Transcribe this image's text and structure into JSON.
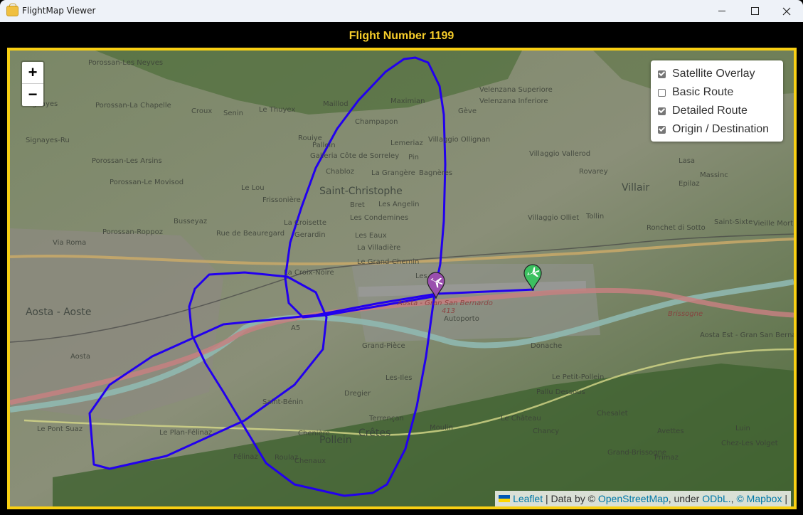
{
  "window": {
    "title": "FlightMap Viewer",
    "minimize_label": "Minimize",
    "maximize_label": "Maximize",
    "close_label": "Close"
  },
  "header": {
    "flight_title": "Flight Number 1199",
    "title_color": "#f5cc2a",
    "frame_color": "#f9d013"
  },
  "map": {
    "zoom_in_label": "+",
    "zoom_out_label": "−",
    "route_color": "#2200ee",
    "origin_marker": {
      "color": "#3cc060",
      "icon": "airplane-icon",
      "role": "origin"
    },
    "destination_marker": {
      "color": "#9a4fae",
      "icon": "airplane-icon",
      "role": "destination"
    },
    "places": [
      {
        "name": "Porossan-Les Neyves"
      },
      {
        "name": "Signayes"
      },
      {
        "name": "Porossan-La Chapelle"
      },
      {
        "name": "Croux"
      },
      {
        "name": "Senin"
      },
      {
        "name": "Le Thuyex"
      },
      {
        "name": "Signayes-Ru"
      },
      {
        "name": "Porossan-Les Arsins"
      },
      {
        "name": "Porossan-Le Movisod"
      },
      {
        "name": "Le Lou"
      },
      {
        "name": "Frissonière"
      },
      {
        "name": "Busseyaz"
      },
      {
        "name": "Porossan-Roppoz"
      },
      {
        "name": "Via Roma"
      },
      {
        "name": "Rue de Beauregard"
      },
      {
        "name": "Aosta - Aoste"
      },
      {
        "name": "Aosta"
      },
      {
        "name": "Maillod"
      },
      {
        "name": "Maximian"
      },
      {
        "name": "Champapon"
      },
      {
        "name": "Gève"
      },
      {
        "name": "Rouiye"
      },
      {
        "name": "Pallein"
      },
      {
        "name": "Galleria Côte de Sorreley"
      },
      {
        "name": "Lemeriaz"
      },
      {
        "name": "Pin"
      },
      {
        "name": "Villaggio Ollignan"
      },
      {
        "name": "Chabloz"
      },
      {
        "name": "La Grangère"
      },
      {
        "name": "Bagnères"
      },
      {
        "name": "Saint-Christophe"
      },
      {
        "name": "Bret"
      },
      {
        "name": "Les Angelin"
      },
      {
        "name": "Les Condemines"
      },
      {
        "name": "La Croisette"
      },
      {
        "name": "Gerardin"
      },
      {
        "name": "Les Eaux"
      },
      {
        "name": "La Villadière"
      },
      {
        "name": "Le Grand-Chemin"
      },
      {
        "name": "La Croix-Noire"
      },
      {
        "name": "Les..."
      },
      {
        "name": "Velenzana Superiore"
      },
      {
        "name": "Velenzana Inferiore"
      },
      {
        "name": "Villaggio Vallerod"
      },
      {
        "name": "Rovarey"
      },
      {
        "name": "Villair"
      },
      {
        "name": "Tollin"
      },
      {
        "name": "Villaggio Olliet"
      },
      {
        "name": "Massinc"
      },
      {
        "name": "Lasa"
      },
      {
        "name": "Epilaz"
      },
      {
        "name": "Ronchet di Sotto"
      },
      {
        "name": "Saint-Sixte"
      },
      {
        "name": "Vieille Mort"
      },
      {
        "name": "Aosta - Gran San Bernardo"
      },
      {
        "name": "413"
      },
      {
        "name": "A5"
      },
      {
        "name": "Autoporto"
      },
      {
        "name": "Grand-Pièce"
      },
      {
        "name": "Les-Iles"
      },
      {
        "name": "Dregier"
      },
      {
        "name": "Saint-Bénin"
      },
      {
        "name": "Pollein"
      },
      {
        "name": "Crêtes"
      },
      {
        "name": "Chenière"
      },
      {
        "name": "Roulaz"
      },
      {
        "name": "Chenaux"
      },
      {
        "name": "Félinaz"
      },
      {
        "name": "Le Plan-Félinaz"
      },
      {
        "name": "Le Pont Suaz"
      },
      {
        "name": "Terrençan"
      },
      {
        "name": "Moulin"
      },
      {
        "name": "Le Château"
      },
      {
        "name": "Le Petit-Pollein"
      },
      {
        "name": "Pallu Dessous"
      },
      {
        "name": "Donache"
      },
      {
        "name": "Chancy"
      },
      {
        "name": "Chesalet"
      },
      {
        "name": "Avettes"
      },
      {
        "name": "Grand-Brissogne"
      },
      {
        "name": "Primaz"
      },
      {
        "name": "Luin"
      },
      {
        "name": "Chez-Les Volget"
      },
      {
        "name": "Aosta Est - Gran San Bernardo Les Îles"
      },
      {
        "name": "Brissogne"
      }
    ]
  },
  "layers": {
    "items": [
      {
        "label": "Satellite Overlay",
        "checked": true
      },
      {
        "label": "Basic Route",
        "checked": false
      },
      {
        "label": "Detailed Route",
        "checked": true
      },
      {
        "label": "Origin / Destination",
        "checked": true
      }
    ]
  },
  "attribution": {
    "leaflet": "Leaflet",
    "sep1": " | Data by © ",
    "osm": "OpenStreetMap",
    "under": ", under ",
    "odbl": "ODbL.",
    "sep2": ", ",
    "mapbox": "© Mapbox",
    "sep3": " |"
  }
}
